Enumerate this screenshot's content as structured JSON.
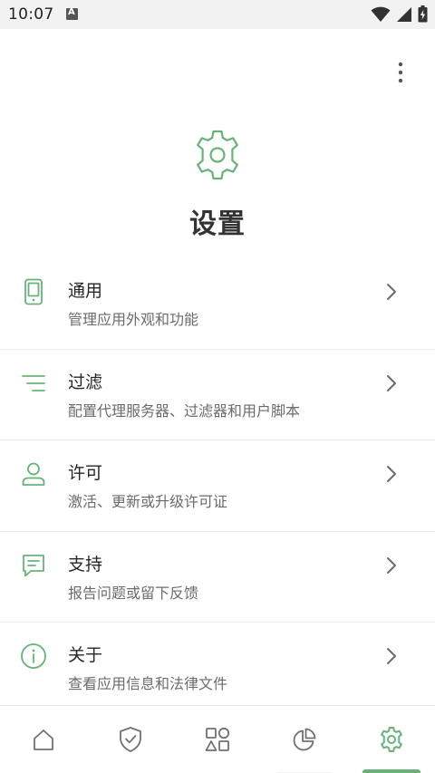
{
  "status_bar": {
    "time": "10:07",
    "notification_icon_letter": "A",
    "icons": [
      "wifi-icon",
      "signal-icon",
      "battery-charging-icon"
    ]
  },
  "header": {
    "title": "设置",
    "hero_icon": "gear-icon",
    "menu_icon": "more-vertical-icon"
  },
  "menu": [
    {
      "icon": "phone-icon",
      "title": "通用",
      "subtitle": "管理应用外观和功能"
    },
    {
      "icon": "filter-lines-icon",
      "title": "过滤",
      "subtitle": "配置代理服务器、过滤器和用户脚本"
    },
    {
      "icon": "person-icon",
      "title": "许可",
      "subtitle": "激活、更新或升级许可证"
    },
    {
      "icon": "chat-icon",
      "title": "支持",
      "subtitle": "报告问题或留下反馈"
    },
    {
      "icon": "info-icon",
      "title": "关于",
      "subtitle": "查看应用信息和法律文件"
    }
  ],
  "bottom_nav": {
    "items": [
      "home-icon",
      "shield-check-icon",
      "apps-grid-icon",
      "pie-chart-icon",
      "gear-icon"
    ],
    "active_index": 4
  },
  "colors": {
    "accent": "#67b279",
    "icon_inactive": "#707070",
    "title_text": "#262626",
    "subtitle_text": "#6b6b6b",
    "status_bar_bg": "#f2f2f2"
  }
}
